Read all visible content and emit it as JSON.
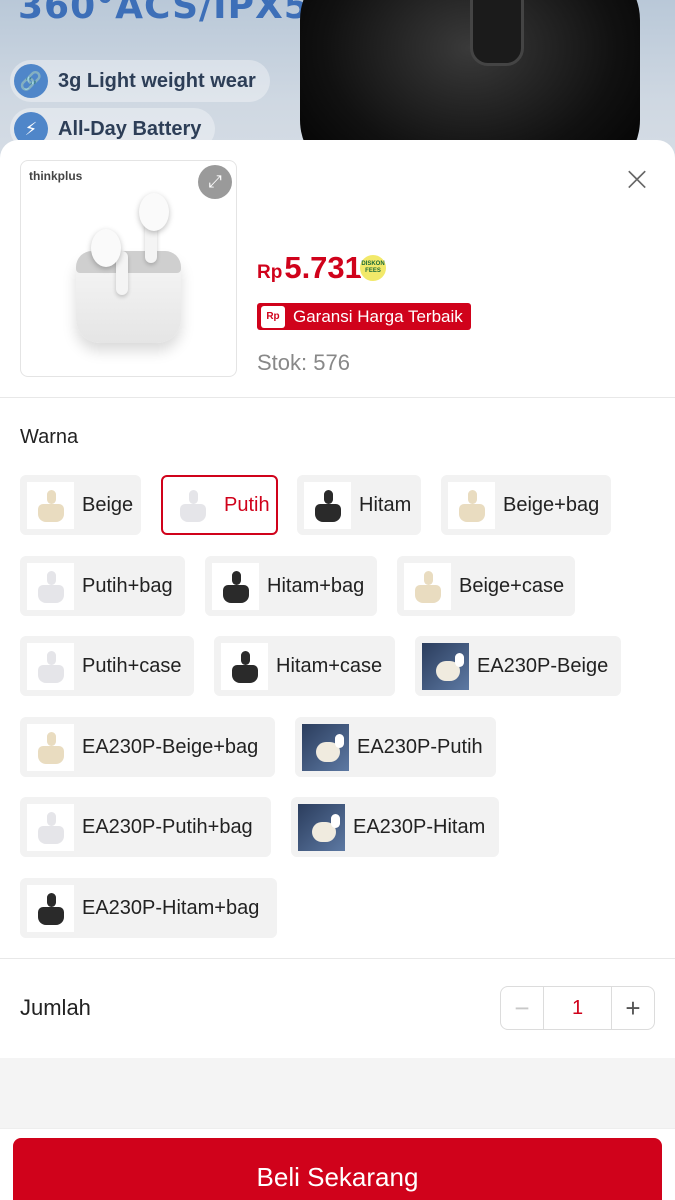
{
  "banner": {
    "heading": "360°ACS/IPX5",
    "features": [
      {
        "icon": "link-icon",
        "label": "3g Light weight wear"
      },
      {
        "icon": "lightning-icon",
        "label": "All-Day Battery"
      }
    ]
  },
  "product": {
    "brand": "thinkplus",
    "currency": "Rp",
    "price": "5.731",
    "badge_text": "DISKON FEES",
    "guarantee_icon_text": "Rp",
    "guarantee_label": "Garansi Harga Terbaik",
    "stock_label": "Stok: 576"
  },
  "variants": {
    "label": "Warna",
    "selected": "Putih",
    "options": [
      {
        "label": "Beige"
      },
      {
        "label": "Putih"
      },
      {
        "label": "Hitam"
      },
      {
        "label": "Beige+bag"
      },
      {
        "label": "Putih+bag"
      },
      {
        "label": "Hitam+bag"
      },
      {
        "label": "Beige+case"
      },
      {
        "label": "Putih+case"
      },
      {
        "label": "Hitam+case"
      },
      {
        "label": "EA230P-Beige"
      },
      {
        "label": "EA230P-Beige+bag"
      },
      {
        "label": "EA230P-Putih"
      },
      {
        "label": "EA230P-Putih+bag"
      },
      {
        "label": "EA230P-Hitam"
      },
      {
        "label": "EA230P-Hitam+bag"
      }
    ]
  },
  "quantity": {
    "label": "Jumlah",
    "value": "1",
    "minus": "−",
    "plus": "+"
  },
  "actions": {
    "buy_label": "Beli Sekarang",
    "close": "×",
    "expand": "⤢"
  },
  "colors": {
    "accent": "#d0021b"
  }
}
